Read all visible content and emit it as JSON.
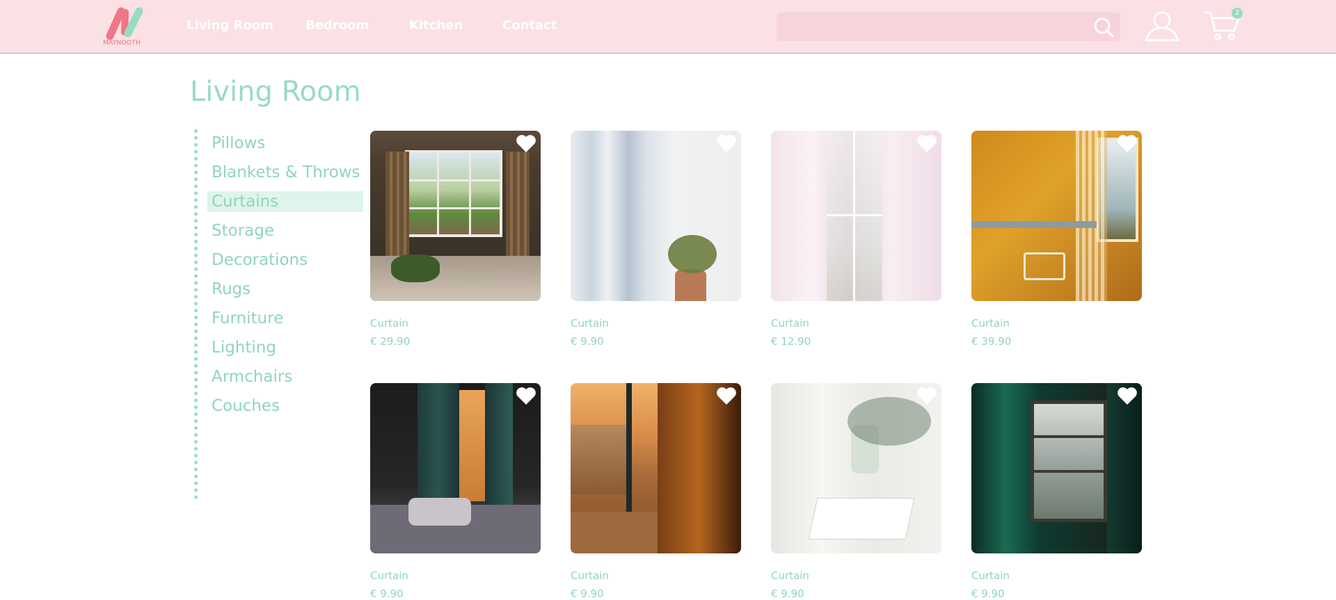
{
  "brand": {
    "logo_text": "MAYNOOTH"
  },
  "nav": {
    "items": [
      {
        "label": "Living Room"
      },
      {
        "label": "Bedroom"
      },
      {
        "label": "Kitchen"
      },
      {
        "label": "Contact"
      }
    ]
  },
  "search": {
    "placeholder": ""
  },
  "cart": {
    "count": "2"
  },
  "page": {
    "title": "Living Room"
  },
  "sidebar": {
    "items": [
      {
        "label": "Pillows",
        "active": false
      },
      {
        "label": "Blankets & Throws",
        "active": false
      },
      {
        "label": "Curtains",
        "active": true
      },
      {
        "label": "Storage",
        "active": false
      },
      {
        "label": "Decorations",
        "active": false
      },
      {
        "label": "Rugs",
        "active": false
      },
      {
        "label": "Furniture",
        "active": false
      },
      {
        "label": "Lighting",
        "active": false
      },
      {
        "label": "Armchairs",
        "active": false
      },
      {
        "label": "Couches",
        "active": false
      }
    ]
  },
  "products": [
    {
      "name": "Curtain",
      "price": "€ 29.90"
    },
    {
      "name": "Curtain",
      "price": "€ 9.90"
    },
    {
      "name": "Curtain",
      "price": "€ 12.90"
    },
    {
      "name": "Curtain",
      "price": "€ 39.90"
    },
    {
      "name": "Curtain",
      "price": "€ 9.90"
    },
    {
      "name": "Curtain",
      "price": "€ 9.90"
    },
    {
      "name": "Curtain",
      "price": "€ 9.90"
    },
    {
      "name": "Curtain",
      "price": "€ 9.90"
    }
  ],
  "colors": {
    "header_bg": "#fbe0e4",
    "accent_mint": "#98dcc0",
    "logo_pink": "#e8707e",
    "active_bg": "#dff4ea"
  },
  "icons": {
    "search": "search-icon",
    "user": "user-icon",
    "cart": "cart-icon",
    "favorite": "heart-icon"
  }
}
